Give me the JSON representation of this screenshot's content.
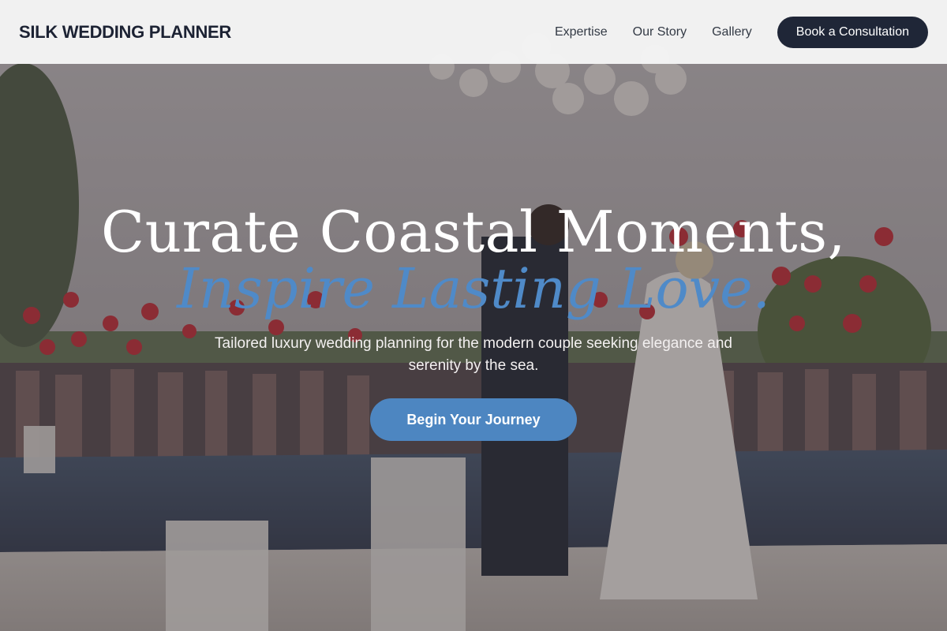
{
  "brand": {
    "name": "SILK WEDDING PLANNER"
  },
  "nav": {
    "links": [
      {
        "label": "Expertise"
      },
      {
        "label": "Our Story"
      },
      {
        "label": "Gallery"
      }
    ],
    "cta_label": "Book a Consultation"
  },
  "hero": {
    "headline_line1": "Curate Coastal Moments,",
    "headline_line2": "Inspire Lasting Love.",
    "subtitle": "Tailored luxury wedding planning for the modern couple seeking elegance and serenity by the sea.",
    "button_label": "Begin Your Journey",
    "background_image": "wedding-couple-balloons-photo"
  },
  "colors": {
    "nav_background": "#f5f5f5",
    "brand_text": "#1c2233",
    "cta_background": "#1f2637",
    "accent_blue": "#4f8ac8",
    "button_blue": "#4d86c1"
  }
}
